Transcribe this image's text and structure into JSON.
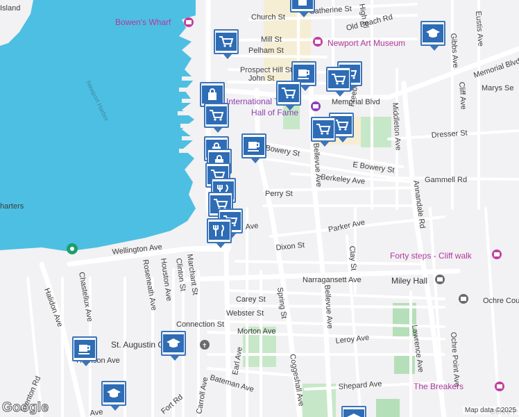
{
  "map": {
    "water_labels": [
      "Newport Harbor"
    ],
    "edge_labels": [
      "Island",
      "harters",
      "Marys Se",
      "Ochre Cou",
      "Ochre P"
    ],
    "streets": [
      "Church St",
      "Catherine St",
      "Old Beach Rd",
      "Mill St",
      "Pelham St",
      "Prospect Hill St",
      "John St",
      "Memorial Blvd",
      "Memorial Blvd",
      "Bowery St",
      "E Bowery St",
      "Berkeley Ave",
      "Perry St",
      "Parker Ave",
      "Dixon St",
      "Wellington Ave",
      "Narragansett Ave",
      "Carey St",
      "Webster St",
      "Connection St",
      "Morton Ave",
      "Leroy Ave",
      "Harrison Ave",
      "Shepard Ave",
      "Bateman Ave",
      "Spring St",
      "Bellevue Ave",
      "Coggeshall Ave",
      "Annandale Rd",
      "Middleton Ave",
      "Freebody St",
      "Dresser St",
      "Gammell Rd",
      "Clay St",
      "Lawrence Ave",
      "Ochre Point Ave",
      "Gibbs Ave",
      "Eustis Ave",
      "Cliff Ave",
      "Chastellux Ave",
      "Halidon Ave",
      "Brenton Rd",
      "Roseneath Ave",
      "Houston Ave",
      "Clinton St",
      "Marchant St",
      "Earl Ave",
      "Carroll Ave",
      "Fort Rd",
      "Ave",
      "Ave",
      "High Pl",
      "Bellevue Ave"
    ],
    "places": [
      "Bowen's Wharf",
      "Newport Art Museum",
      "International Tennis",
      "Hall of Fame",
      "Forty steps - Cliff walk",
      "Miley Hall",
      "The Breakers",
      "St. Augustin Church"
    ],
    "markers": [
      "shopping-cart",
      "shopping-cart",
      "shopping-cart",
      "shopping-cart",
      "shopping-cart",
      "shopping-cart",
      "shopping-cart",
      "shopping-cart",
      "shopping-cart",
      "coffee",
      "coffee",
      "coffee",
      "school",
      "school",
      "school",
      "school",
      "restaurant",
      "restaurant",
      "shopping-bag",
      "shopping-bag",
      "shopping-bag"
    ],
    "attribution": "Map data ©2025",
    "logo": "Google"
  }
}
